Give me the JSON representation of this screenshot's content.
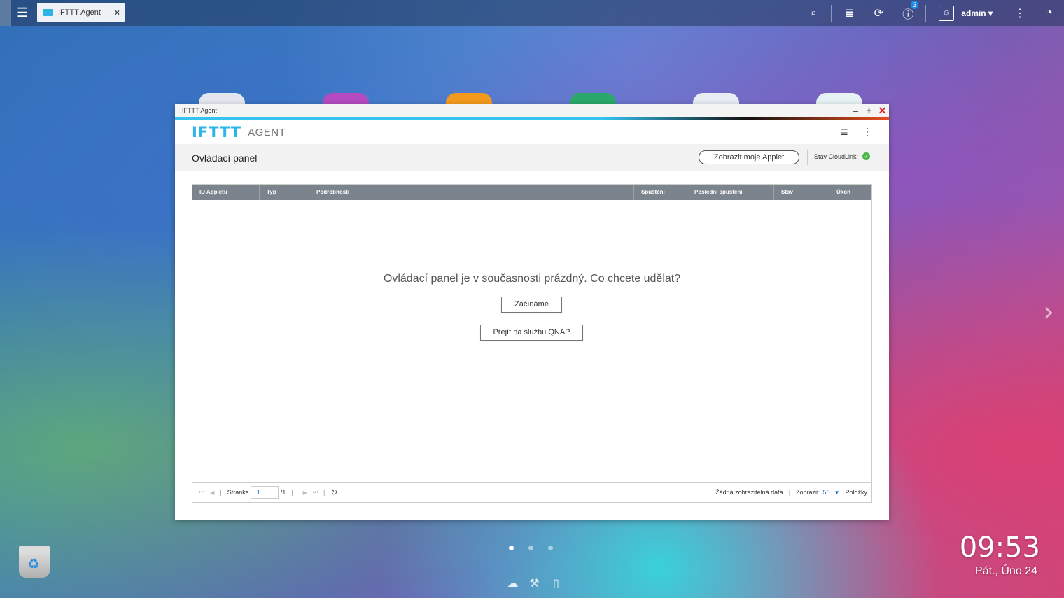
{
  "topbar": {
    "tab_label": "IFTTT Agent",
    "tab_close": "×",
    "notification_count": "3",
    "user": "admin ▾"
  },
  "window": {
    "title": "IFTTT Agent",
    "logo": "IFTTT",
    "app_name": "AGENT",
    "controls": {
      "minimize": "–",
      "maximize": "+",
      "close": "✕"
    }
  },
  "subhead": {
    "title": "Ovládací panel",
    "show_applet_label": "Zobrazit moje Applet",
    "cloudlink_label": "Stav CloudLink:"
  },
  "table": {
    "columns": [
      "ID Appletu",
      "Typ",
      "Podrobnosti",
      "Spuštění",
      "Poslední spuštění",
      "Stav",
      "Úkon"
    ],
    "empty_message": "Ovládací panel je v současnosti prázdný. Co chcete udělat?",
    "start_button": "Začínáme",
    "qnap_button": "Přejít na službu QNAP"
  },
  "pager": {
    "page_label": "Stránka",
    "page_value": "1",
    "total_pages": "/1",
    "no_data": "Žádná zobrazitelná data",
    "show_label": "Zobrazit",
    "per_page": "50",
    "items_label": "Položky"
  },
  "desktop": {
    "time": "09:53",
    "date": "Pát., Úno 24"
  },
  "colors": {
    "accent": "#2bb5e8",
    "close": "#e02020",
    "status_ok": "#4cb648",
    "header_bg": "#7b838d"
  }
}
